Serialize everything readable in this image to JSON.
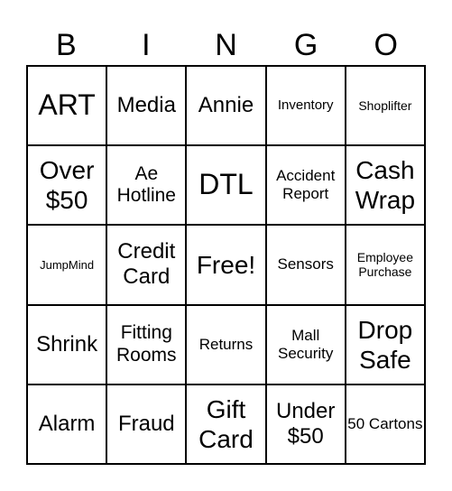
{
  "header": {
    "letters": [
      "B",
      "I",
      "N",
      "G",
      "O"
    ]
  },
  "cells": [
    [
      "ART",
      "Media",
      "Annie",
      "Inventory",
      "Shoplifter"
    ],
    [
      "Over $50",
      "Ae Hotline",
      "DTL",
      "Accident Report",
      "Cash Wrap"
    ],
    [
      "JumpMind",
      "Credit Card",
      "Free!",
      "Sensors",
      "Employee Purchase"
    ],
    [
      "Shrink",
      "Fitting Rooms",
      "Returns",
      "Mall Security",
      "Drop Safe"
    ],
    [
      "Alarm",
      "Fraud",
      "Gift Card",
      "Under $50",
      "50 Cartons"
    ]
  ]
}
